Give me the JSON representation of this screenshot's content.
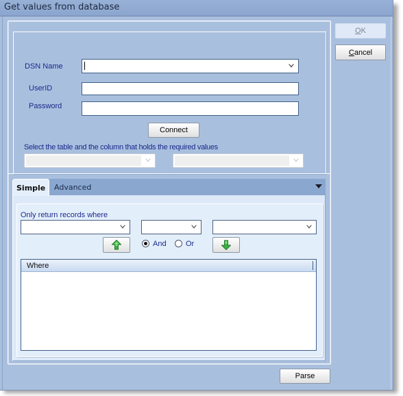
{
  "window": {
    "title": "Get values from database"
  },
  "actions": {
    "ok_label": "OK",
    "ok_mnemonic": "O",
    "ok_rest": "K",
    "cancel_label": "Cancel",
    "cancel_mnemonic": "C",
    "cancel_rest": "ancel",
    "parse_label": "Parse"
  },
  "connection": {
    "dsn_label": "DSN Name",
    "dsn_value": "",
    "userid_label": "UserID",
    "userid_value": "",
    "password_label": "Password",
    "password_value": "",
    "connect_label": "Connect",
    "table_column_hint": "Select the table and the column that holds the required values",
    "table_value": "",
    "column_value": ""
  },
  "tabs": [
    {
      "label": "Simple",
      "active": true
    },
    {
      "label": "Advanced",
      "active": false
    }
  ],
  "simple": {
    "filter_label": "Only return records where",
    "field_value": "",
    "operator_value": "",
    "criteria_value": "",
    "conjunction_options": [
      {
        "label": "And",
        "selected": true
      },
      {
        "label": "Or",
        "selected": false
      }
    ],
    "grid": {
      "columns": [
        "Where"
      ],
      "rows": []
    }
  },
  "icons": {
    "add_up": "green-up-arrow-icon",
    "remove_down": "green-down-arrow-icon",
    "dropdown": "chevron-down-icon",
    "tab_menu": "triangle-down-icon"
  },
  "colors": {
    "window_bg": "#a9bfde",
    "titlebar": "#8ba6cf",
    "label_text": "#1a2a8a",
    "tab_body": "#dde9f8",
    "arrow_green": "#3cb043"
  }
}
